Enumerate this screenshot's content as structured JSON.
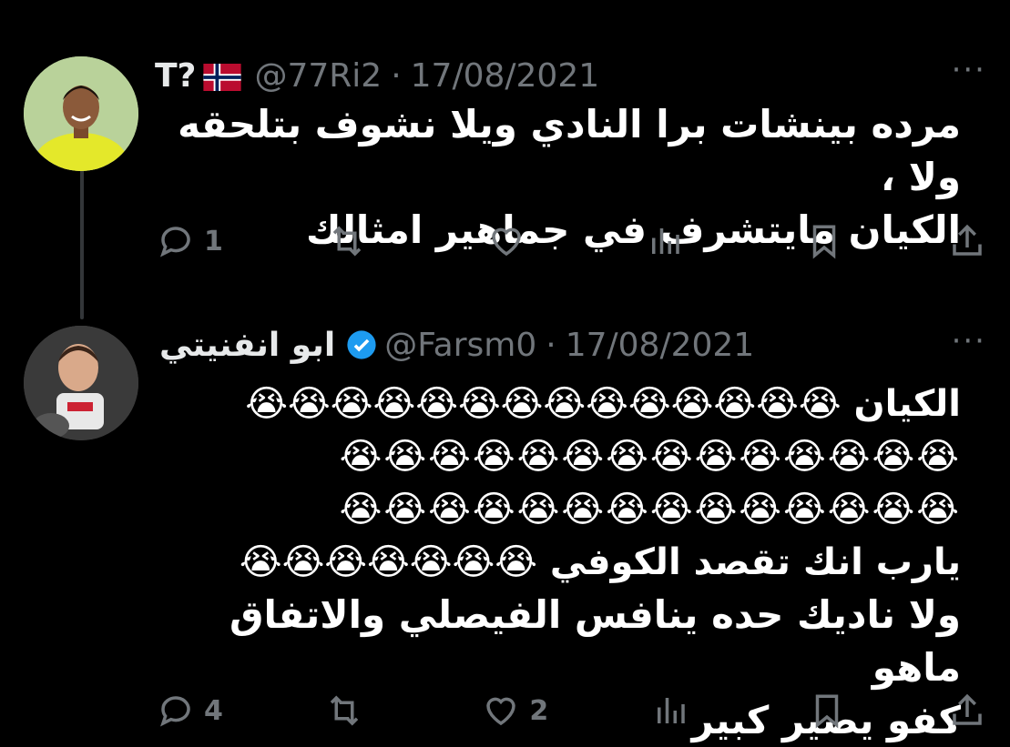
{
  "tweets": [
    {
      "name": "T?",
      "handle": "@77Ri2",
      "separator": "·",
      "date": "17/08/2021",
      "text_lines": [
        "مرده بينشات برا النادي ويلا نشوف بتلحقه ولا ،",
        "الكيان مايتشرف في جماهير امثالك"
      ],
      "reply_count": "1",
      "like_count": ""
    },
    {
      "name": "ابو انفنيتي",
      "handle": "@Farsm0",
      "separator": "·",
      "date": "17/08/2021",
      "text_lines": [
        "الكيان 😭😭😭😭😭😭😭😭😭😭😭😭😭😭",
        "😭😭😭😭😭😭😭😭😭😭😭😭😭😭",
        "😭😭😭😭😭😭😭😭😭😭😭😭😭😭",
        "يارب انك تقصد الكوفي 😭😭😭😭😭😭😭",
        "ولا ناديك حده ينافس الفيصلي والاتفاق ماهو",
        "كفو يصير كبير"
      ],
      "reply_count": "4",
      "like_count": "2"
    }
  ],
  "icons": [
    "reply-icon",
    "retweet-icon",
    "like-icon",
    "views-icon",
    "bookmark-icon",
    "share-icon",
    "more-icon",
    "verified-icon",
    "norway-flag-icon"
  ],
  "colors": {
    "background": "#000000",
    "text": "#e7e9ea",
    "muted": "#71767b",
    "verified": "#1d9bf0"
  }
}
